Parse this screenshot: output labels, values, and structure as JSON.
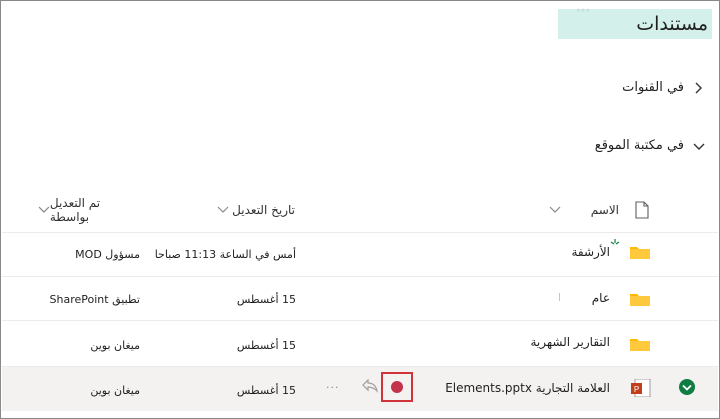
{
  "header": {
    "title": "مستندات",
    "tab_hint": "◦◦◦"
  },
  "sections": {
    "channels": "في القنوات",
    "site_library": "في مكتبة الموقع"
  },
  "columns": {
    "name": "الاسم",
    "modified": "تاريخ التعديل",
    "modified_by": "تم التعديل بواسطة"
  },
  "rows": [
    {
      "name": "الأرشفة",
      "modified": "أمس في الساعة 11:13 صباحا",
      "modified_by": "مسؤول MOD"
    },
    {
      "name": "عام",
      "modified": "15 أغسطس",
      "modified_by": "تطبيق SharePoint"
    },
    {
      "name": "التقارير الشهرية",
      "modified": "15 أغسطس",
      "modified_by": "ميغان بوين"
    },
    {
      "name": "العلامة التجارية Elements.pptx",
      "modified": "15 أغسطس",
      "modified_by": "ميغان بوين"
    }
  ],
  "row_actions": {
    "more": "···"
  },
  "colors": {
    "accent": "#107c41",
    "folder": "#ffb900",
    "highlight": "#d4f0ea",
    "error_box": "#d13438",
    "ppt": "#c43e1c"
  },
  "icons": [
    "chevron-right-icon",
    "chevron-down-icon",
    "file-type-icon",
    "sort-chevron-icon",
    "folder-icon",
    "new-item-sparkle-icon",
    "pptx-icon",
    "selected-check-icon",
    "checkout-status-icon",
    "share-icon",
    "more-icon"
  ]
}
